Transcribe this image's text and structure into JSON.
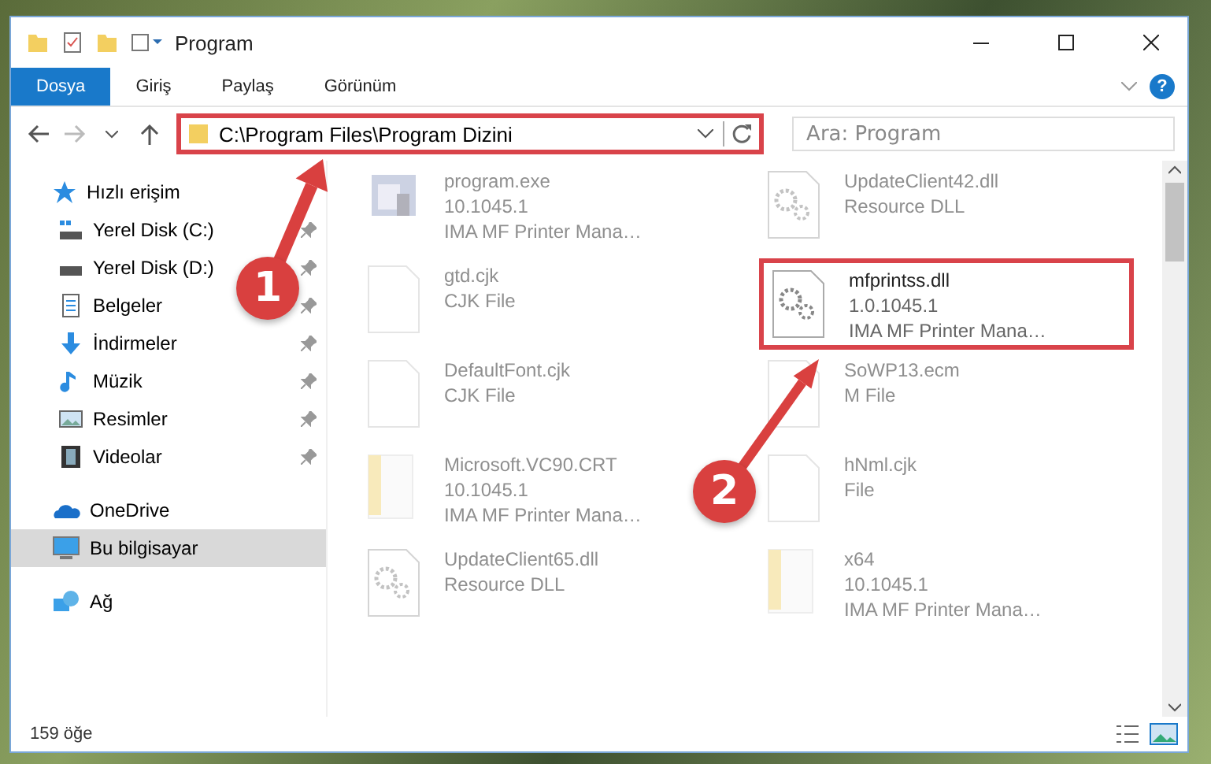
{
  "window": {
    "title": "Program"
  },
  "ribbon": {
    "tabs": [
      {
        "label": "Dosya",
        "selected": true
      },
      {
        "label": "Giriş",
        "selected": false
      },
      {
        "label": "Paylaş",
        "selected": false
      },
      {
        "label": "Görünüm",
        "selected": false
      }
    ],
    "help": "?"
  },
  "address_bar": {
    "path": "C:\\Program Files\\Program Dizini",
    "highlighted": true
  },
  "search": {
    "placeholder": "Ara: Program"
  },
  "sidebar": {
    "items": [
      {
        "label": "Hızlı erişim",
        "kind": "star",
        "pinned": false,
        "selected": false,
        "children": [
          {
            "label": "Yerel Disk (C:)",
            "kind": "drive-c",
            "pinned": true,
            "selected": false
          },
          {
            "label": "Yerel Disk (D:)",
            "kind": "drive",
            "pinned": true,
            "selected": false
          },
          {
            "label": "Belgeler",
            "kind": "docs",
            "pinned": true,
            "selected": false
          },
          {
            "label": "İndirmeler",
            "kind": "download",
            "pinned": true,
            "selected": false
          },
          {
            "label": "Müzik",
            "kind": "music",
            "pinned": true,
            "selected": false
          },
          {
            "label": "Resimler",
            "kind": "pictures",
            "pinned": true,
            "selected": false
          },
          {
            "label": "Videolar",
            "kind": "videos",
            "pinned": true,
            "selected": false
          }
        ]
      },
      {
        "label": "OneDrive",
        "kind": "cloud",
        "pinned": false,
        "selected": false
      },
      {
        "label": "Bu bilgisayar",
        "kind": "pc",
        "pinned": false,
        "selected": true
      },
      {
        "label": "Ağ",
        "kind": "network",
        "pinned": false,
        "selected": false
      }
    ]
  },
  "files": [
    {
      "name": "program.exe",
      "lines": [
        "10.1045.1",
        "IMA MF Printer Mana…"
      ],
      "kind": "exe",
      "faded": true,
      "highlighted": false
    },
    {
      "name": "UpdateClient42.dll",
      "lines": [
        "Resource DLL"
      ],
      "kind": "dll",
      "faded": true,
      "highlighted": false
    },
    {
      "name": "gtd.cjk",
      "lines": [
        "CJK File"
      ],
      "kind": "file",
      "faded": true,
      "highlighted": false
    },
    {
      "name": "mfprintss.dll",
      "lines": [
        "1.0.1045.1",
        "IMA MF Printer Mana…"
      ],
      "kind": "dll",
      "faded": false,
      "highlighted": true
    },
    {
      "name": "DefaultFont.cjk",
      "lines": [
        "CJK File"
      ],
      "kind": "file",
      "faded": true,
      "highlighted": false
    },
    {
      "name": "SoWP13.ecm",
      "lines": [
        "M File"
      ],
      "kind": "file",
      "faded": true,
      "highlighted": false
    },
    {
      "name": "Microsoft.VC90.CRT",
      "lines": [
        "10.1045.1",
        "IMA MF Printer Mana…"
      ],
      "kind": "folder",
      "faded": true,
      "highlighted": false
    },
    {
      "name": "hNml.cjk",
      "lines": [
        "File"
      ],
      "kind": "file",
      "faded": true,
      "highlighted": false
    },
    {
      "name": "UpdateClient65.dll",
      "lines": [
        "Resource DLL"
      ],
      "kind": "dll",
      "faded": true,
      "highlighted": false
    },
    {
      "name": "x64",
      "lines": [
        "10.1045.1",
        "IMA MF Printer Mana…"
      ],
      "kind": "folder",
      "faded": true,
      "highlighted": false
    }
  ],
  "status_bar": {
    "count": "159 öğe"
  },
  "annotations": [
    {
      "number": "1"
    },
    {
      "number": "2"
    }
  ]
}
